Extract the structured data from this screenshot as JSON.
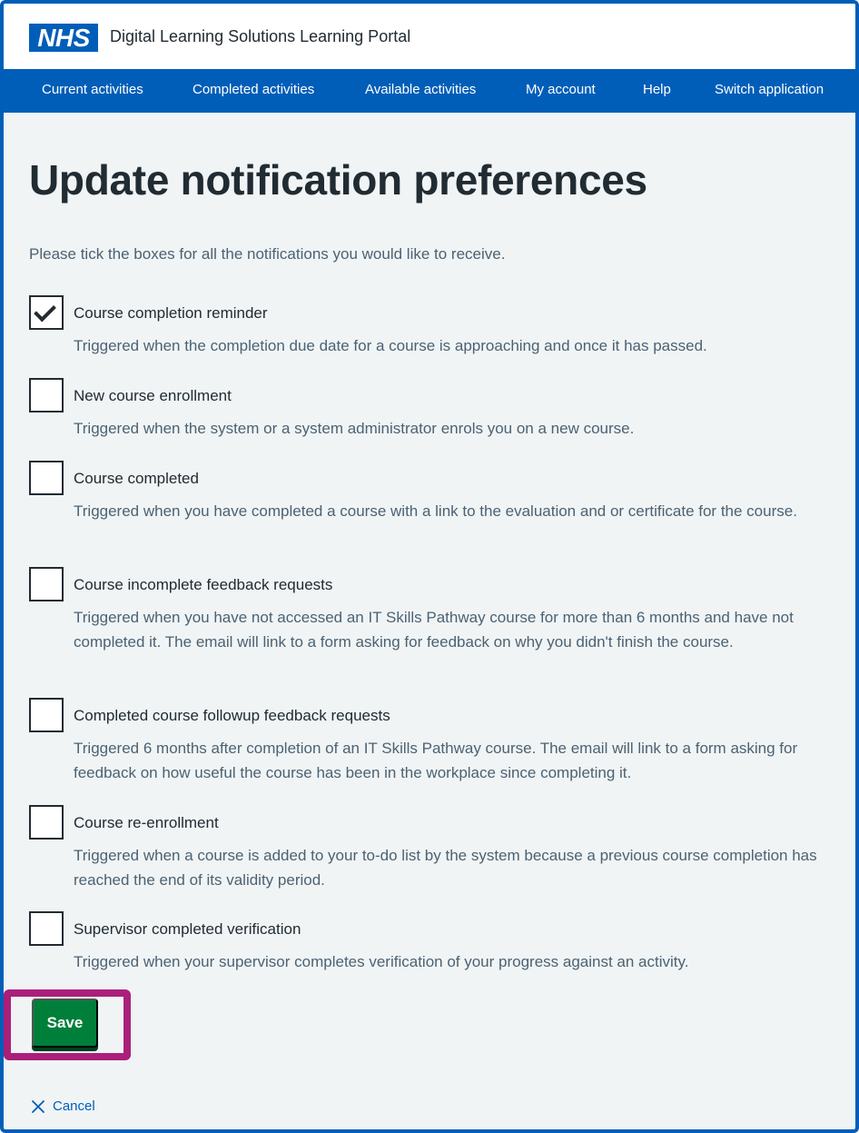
{
  "header": {
    "logo_text": "NHS",
    "service_name": "Digital Learning Solutions Learning Portal"
  },
  "nav": {
    "items": [
      {
        "label": "Current activities"
      },
      {
        "label": "Completed activities"
      },
      {
        "label": "Available activities"
      },
      {
        "label": "My account"
      },
      {
        "label": "Help"
      },
      {
        "label": "Switch application"
      }
    ]
  },
  "main": {
    "title": "Update notification preferences",
    "intro": "Please tick the boxes for all the notifications you would like to receive.",
    "options": [
      {
        "label": "Course completion reminder",
        "hint": "Triggered when the completion due date for a course is approaching and once it has passed.",
        "checked": true
      },
      {
        "label": "New course enrollment",
        "hint": "Triggered when the system or a system administrator enrols you on a new course.",
        "checked": false
      },
      {
        "label": "Course completed",
        "hint": "Triggered when you have completed a course with a link to the evaluation and or certificate for the course.",
        "checked": false
      },
      {
        "label": "Course incomplete feedback requests",
        "hint": "Triggered when you have not accessed an IT Skills Pathway course for more than 6 months and have not completed it. The email will link to a form asking for feedback on why you didn't finish the course.",
        "checked": false
      },
      {
        "label": "Completed course followup feedback requests",
        "hint": "Triggered 6 months after completion of an IT Skills Pathway course. The email will link to a form asking for feedback on how useful the course has been in the workplace since completing it.",
        "checked": false
      },
      {
        "label": "Course re-enrollment",
        "hint": "Triggered when a course is added to your to-do list by the system because a previous course completion has reached the end of its validity period.",
        "checked": false
      },
      {
        "label": "Supervisor completed verification",
        "hint": "Triggered when your supervisor completes verification of your progress against an activity.",
        "checked": false
      }
    ],
    "save_label": "Save",
    "cancel_label": "Cancel"
  },
  "colors": {
    "nhs_blue": "#005eb8",
    "save_green": "#007f3b",
    "focus_magenta": "#aa1f7a",
    "page_bg": "#f0f4f5"
  }
}
